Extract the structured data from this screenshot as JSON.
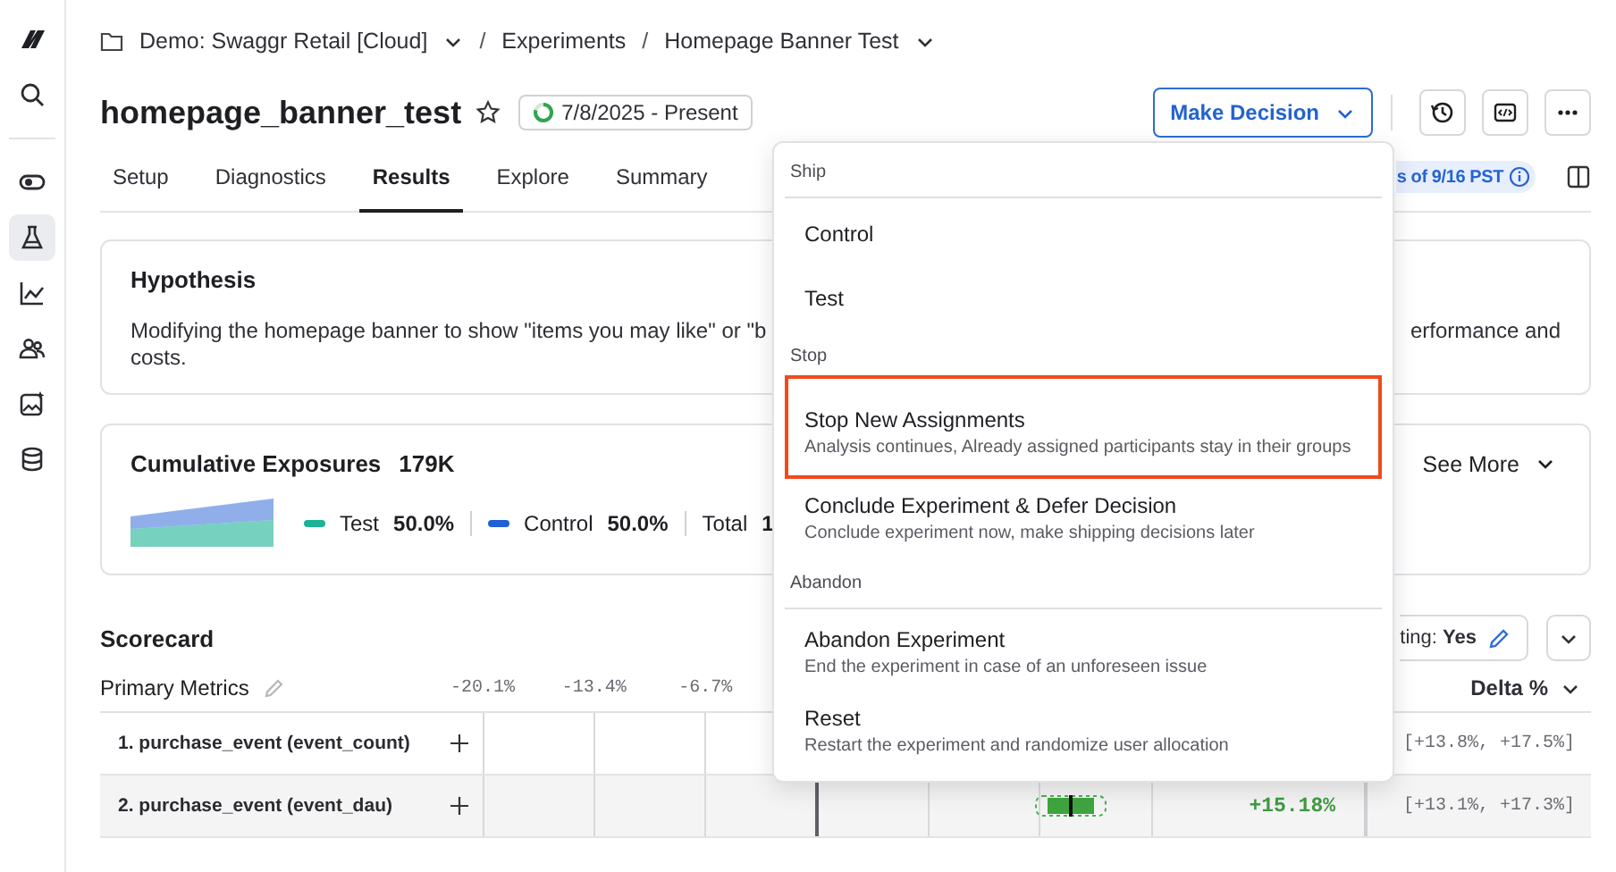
{
  "sidebar": {
    "items": [
      {
        "selected": false
      },
      {
        "selected": false
      },
      {
        "selected": false
      },
      {
        "selected": true
      },
      {
        "selected": false
      },
      {
        "selected": false
      },
      {
        "selected": false
      },
      {
        "selected": false
      }
    ]
  },
  "breadcrumb": {
    "separator": "/",
    "items": [
      {
        "label": "Demo: Swaggr Retail [Cloud]",
        "dropdown": true
      },
      {
        "label": "Experiments",
        "dropdown": false
      },
      {
        "label": "Homepage Banner Test",
        "dropdown": true
      }
    ]
  },
  "header": {
    "title": "homepage_banner_test",
    "starred": false,
    "status": "7/8/2025 - Present",
    "decision_button": "Make Decision"
  },
  "tabs": [
    {
      "label": "Setup",
      "selected": false
    },
    {
      "label": "Diagnostics",
      "selected": false
    },
    {
      "label": "Results",
      "selected": true
    },
    {
      "label": "Explore",
      "selected": false
    },
    {
      "label": "Summary",
      "selected": false
    }
  ],
  "results_badge": "s of 9/16 PST",
  "hypothesis": {
    "title": "Hypothesis",
    "text_left": "Modifying the homepage banner to show \"items you may like\" or \"b",
    "text_right": "erformance and",
    "text_line2": "costs."
  },
  "exposures": {
    "title": "Cumulative Exposures",
    "count": "179K",
    "see_more": "See More",
    "legend": [
      {
        "label": "Test",
        "value": "50.0%",
        "color": "#1db394"
      },
      {
        "label": "Control",
        "value": "50.0%",
        "color": "#2160d6"
      }
    ],
    "total_label": "Total",
    "total_value": "1"
  },
  "scorecard": {
    "title": "Scorecard",
    "setting_button": "ting: **Yes**",
    "section": "Primary Metrics",
    "axis_ticks": [
      "-20.1%",
      "-13.4%",
      "-6.7%"
    ],
    "delta_header": "Delta %",
    "rows": [
      {
        "name": "1. purchase_event (event_count)",
        "ci": "[+13.8%, +17.5%]"
      },
      {
        "name": "2. purchase_event (event_dau)",
        "delta": "+15.18%",
        "ci": "[+13.1%, +17.3%]"
      }
    ]
  },
  "decision_menu": {
    "sections": [
      {
        "title": "Ship",
        "divider": true,
        "items": [
          {
            "label": "Control",
            "highlighted": false
          },
          {
            "label": "Test",
            "highlighted": false
          }
        ]
      },
      {
        "title": "Stop",
        "divider": false,
        "items": [
          {
            "label": "Stop New Assignments",
            "description": "Analysis continues, Already assigned participants stay in their groups",
            "highlighted": true
          },
          {
            "label": "Conclude Experiment & Defer Decision",
            "description": "Conclude experiment now, make shipping decisions later",
            "highlighted": false
          }
        ]
      },
      {
        "title": "Abandon",
        "divider": true,
        "items": [
          {
            "label": "Abandon Experiment",
            "description": "End the experiment in case of an unforeseen issue",
            "highlighted": false
          },
          {
            "label": "Reset",
            "description": "Restart the experiment and randomize user allocation",
            "highlighted": false
          }
        ]
      }
    ]
  }
}
